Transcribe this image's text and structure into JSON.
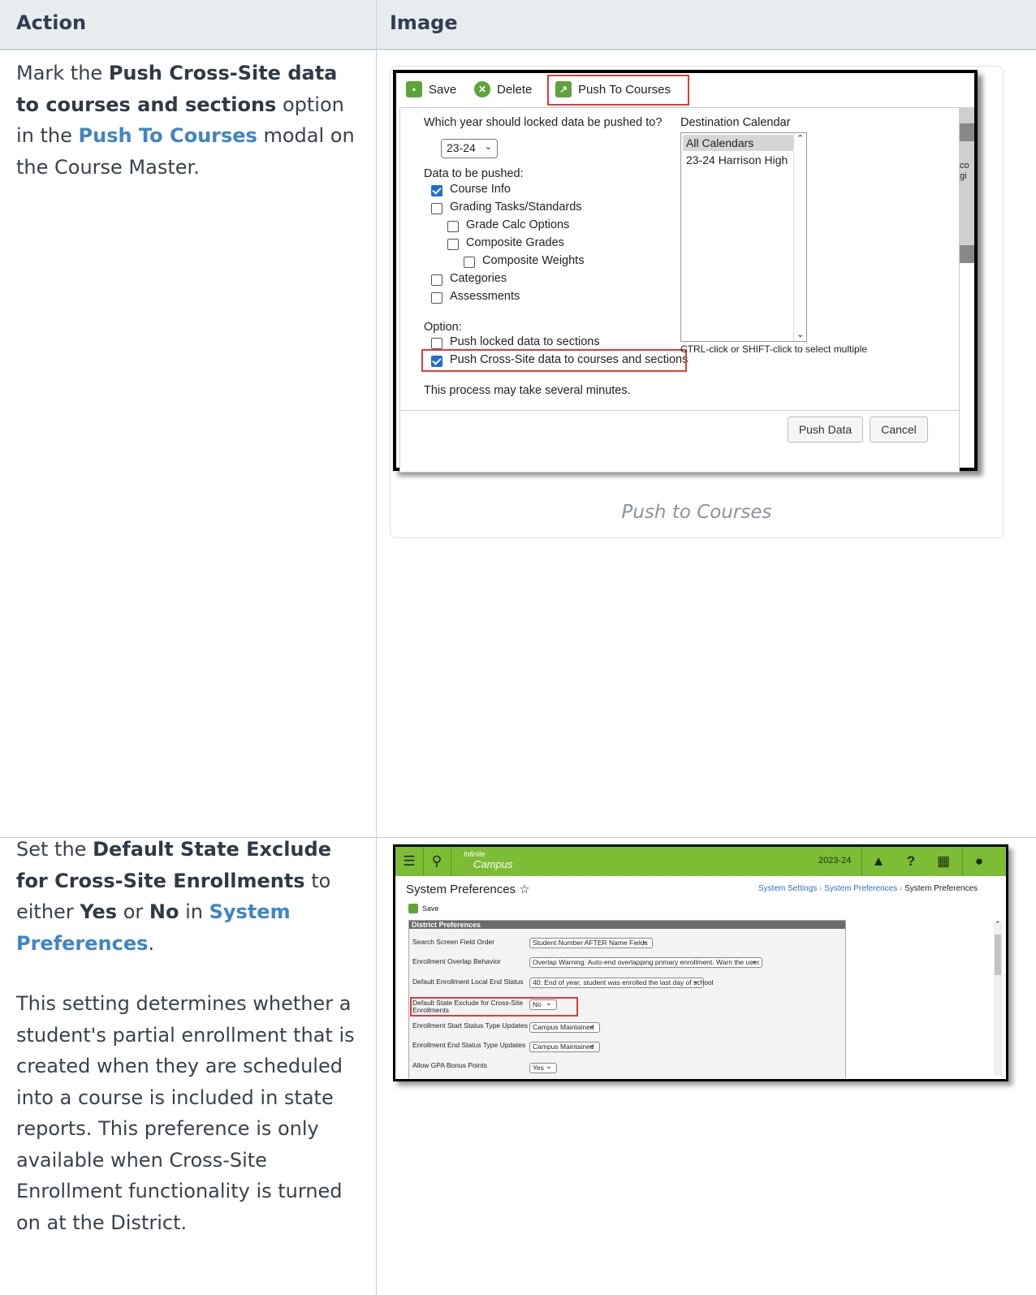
{
  "header": {
    "action": "Action",
    "image": "Image"
  },
  "row1": {
    "action": {
      "p1": "Mark the ",
      "b1": "Push Cross-Site data to courses and sections",
      "p2": " option in the ",
      "link1": "Push To Courses",
      "p3": " modal on the Course Master."
    },
    "caption": "Push to Courses",
    "screenshot": {
      "toolbar": {
        "save": "Save",
        "delete": "Delete",
        "push": "Push To Courses"
      },
      "year_question": "Which year should locked data be pushed to?",
      "year_value": "23-24",
      "data_label": "Data to be pushed:",
      "checkboxes": [
        {
          "label": "Course Info",
          "checked": true
        },
        {
          "label": "Grading Tasks/Standards",
          "checked": false
        },
        {
          "label": "Grade Calc Options",
          "checked": false
        },
        {
          "label": "Composite Grades",
          "checked": false
        },
        {
          "label": "Composite Weights",
          "checked": false
        },
        {
          "label": "Categories",
          "checked": false
        },
        {
          "label": "Assessments",
          "checked": false
        }
      ],
      "option_label": "Option:",
      "options": [
        {
          "label": "Push locked data to sections",
          "checked": false
        },
        {
          "label": "Push Cross-Site data to courses and sections",
          "checked": true
        }
      ],
      "note": "This process may take several minutes.",
      "dest_label": "Destination Calendar",
      "calendars": [
        "All Calendars",
        "23-24 Harrison High"
      ],
      "hint": "CTRL-click or SHIFT-click to select multiple",
      "side_fragment_1": "co",
      "side_fragment_2": "gi",
      "buttons": {
        "push": "Push Data",
        "cancel": "Cancel"
      }
    }
  },
  "row2": {
    "action": {
      "p1": "Set the ",
      "b1": "Default State Exclude for Cross-Site Enrollments",
      "p2": " to either ",
      "b2": "Yes",
      "p3": " or ",
      "b3": "No",
      "p4": " in ",
      "link1": "System Preferences",
      "p5": ".",
      "para2": "This setting determines whether a student's partial enrollment that is created when they are scheduled into a course is included in state reports. This preference is only available when Cross-Site Enrollment functionality is turned on at the District."
    },
    "screenshot": {
      "logo_top": "Infinite",
      "logo_bottom": "Campus",
      "year": "2023-24",
      "title": "System Preferences ☆",
      "breadcrumb": [
        "System Settings",
        "System Preferences",
        "System Preferences"
      ],
      "save": "Save",
      "section": "District Preferences",
      "prefs": [
        {
          "label": "Search Screen Field Order",
          "value": "Student Number AFTER Name Fields"
        },
        {
          "label": "Enrollment Overlap Behavior",
          "value": "Overlap Warning: Auto-end overlapping primary enrollment. Warn the user."
        },
        {
          "label": "Default Enrollment Local End Status",
          "value": "40: End of year; student was enrolled the last day of school"
        },
        {
          "label": "Default State Exclude for Cross-Site Enrollments",
          "value": "No"
        },
        {
          "label": "Enrollment Start Status Type Updates",
          "value": "Campus Maintained"
        },
        {
          "label": "Enrollment End Status Type Updates",
          "value": "Campus Maintained"
        },
        {
          "label": "Allow GPA Bonus Points",
          "value": "Yes"
        }
      ]
    }
  }
}
